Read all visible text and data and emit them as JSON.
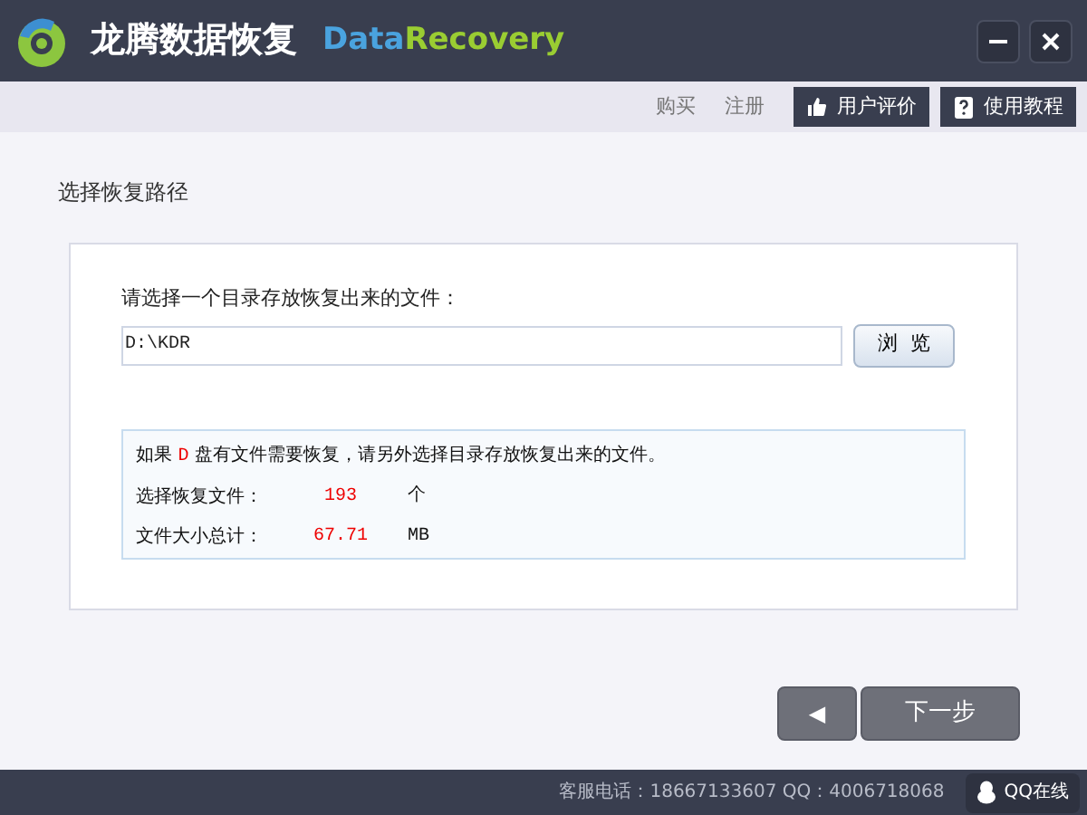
{
  "window": {
    "title": "龙腾数据恢复",
    "brand": [
      {
        "text": "Data",
        "color": "#4aa3df"
      },
      {
        "text": "Recovery",
        "color": "#9acd32"
      }
    ]
  },
  "toolbar": {
    "links": [
      "购买",
      "注册"
    ],
    "buttons": [
      {
        "label": "用户评价",
        "kind": "thumb"
      },
      {
        "label": "使用教程",
        "kind": "help"
      }
    ]
  },
  "section_title": "选择恢复路径",
  "path": {
    "label": "请选择一个目录存放恢复出来的文件：",
    "value": "D:\\KDR",
    "browse": "浏  览"
  },
  "info": {
    "before": "如果",
    "drive": "D",
    "after": "盘有文件需要恢复，请另外选择目录存放恢复出来的文件。",
    "rows": [
      {
        "label": "选择恢复文件：",
        "value": "193",
        "unit": "个"
      },
      {
        "label": "文件大小总计：",
        "value": "67.71",
        "unit": "MB"
      }
    ]
  },
  "nav": {
    "back": "◀",
    "next": "下一步"
  },
  "footer": {
    "contact": "客服电话：18667133607 QQ：4006718068",
    "qq": "QQ在线"
  }
}
